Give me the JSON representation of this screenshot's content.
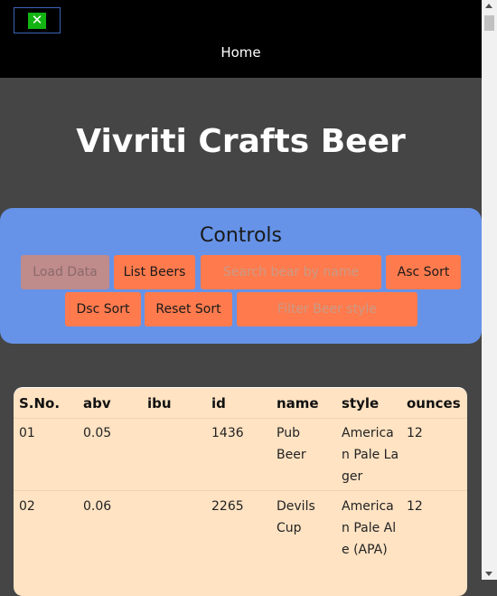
{
  "nav": {
    "toggle_icon": "close-icon",
    "toggle_glyph": "✕",
    "home": "Home"
  },
  "page": {
    "title": "Vivriti Crafts Beer"
  },
  "controls": {
    "title": "Controls",
    "load_data": "Load Data",
    "list_beers": "List Beers",
    "search_placeholder": "Search bear by name",
    "asc_sort": "Asc Sort",
    "dsc_sort": "Dsc Sort",
    "reset_sort": "Reset Sort",
    "filter_placeholder": "Filter Beer style"
  },
  "table": {
    "headers": [
      "S.No.",
      "abv",
      "ibu",
      "id",
      "name",
      "style",
      "ounces"
    ],
    "rows": [
      [
        "01",
        "0.05",
        "",
        "1436",
        "Pub Beer",
        "American Pale Lager",
        "12"
      ],
      [
        "02",
        "0.06",
        "",
        "2265",
        "Devils Cup",
        "American Pale Ale (APA)",
        "12"
      ]
    ]
  },
  "colors": {
    "page_bg": "#454545",
    "navbar_bg": "#000000",
    "controls_bg": "#6693e8",
    "button_bg": "#ff7b4e",
    "table_bg": "#ffe3c3"
  }
}
